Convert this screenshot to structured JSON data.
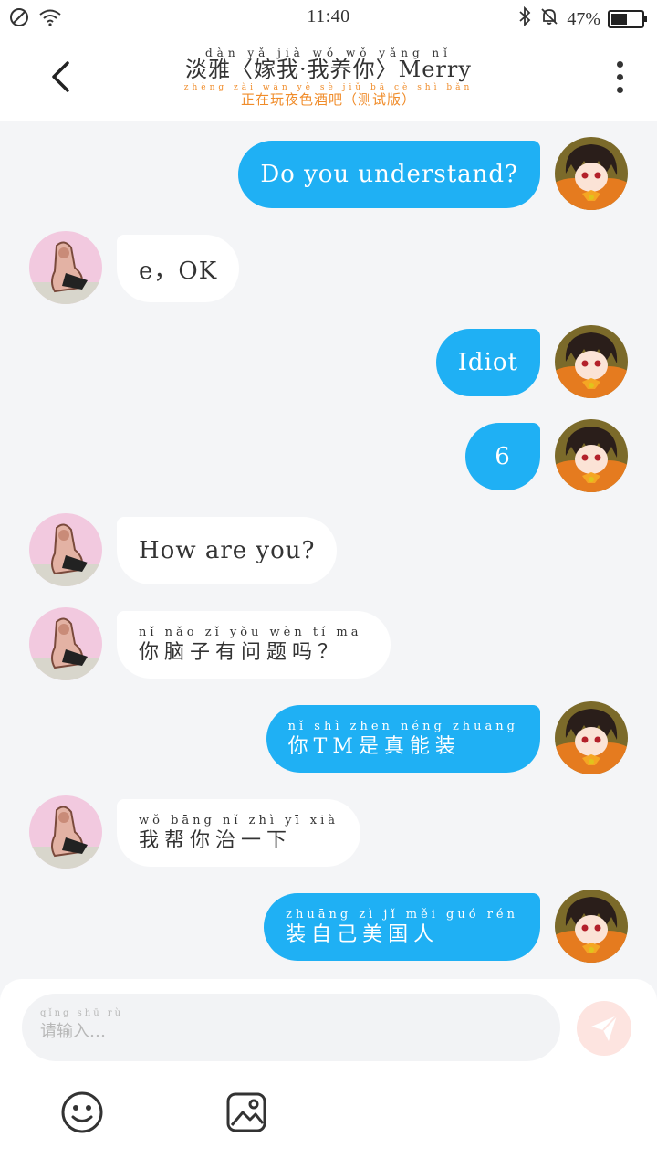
{
  "status_bar": {
    "time": "11:40",
    "battery": "47%",
    "battery_level": 0.47
  },
  "header": {
    "title_pinyin": "dàn yǎ  jià wǒ  wǒ yǎng nǐ",
    "title": "淡雅〈嫁我·我养你〉Merry",
    "subtitle_pinyin": "zhèng zài wán yè sè jiǔ bā  cè shì bǎn",
    "subtitle": "正在玩夜色酒吧（测试版）"
  },
  "messages": [
    {
      "side": "right",
      "text": "Do you understand?"
    },
    {
      "side": "left",
      "text": "e，OK"
    },
    {
      "side": "right",
      "text": "Idiot"
    },
    {
      "side": "right",
      "text": "6"
    },
    {
      "side": "left",
      "text": "How are you?"
    },
    {
      "side": "left",
      "pinyin": "nǐ nǎo zǐ yǒu wèn tí ma",
      "text": "你脑子有问题吗？"
    },
    {
      "side": "right",
      "pinyin": "nǐ     shì zhēn néng zhuāng",
      "text": "你TM是真能装"
    },
    {
      "side": "left",
      "pinyin": "wǒ bāng nǐ zhì yī xià",
      "text": "我帮你治一下"
    },
    {
      "side": "right",
      "pinyin": "zhuāng zì jǐ měi guó rén",
      "text": "装自己美国人"
    }
  ],
  "composer": {
    "placeholder_pinyin": "qǐng shū rù",
    "placeholder": "请输入…"
  },
  "colors": {
    "accent": "#1fb0f4",
    "subtitle": "#f08c2a",
    "send_button": "#fde4e0"
  },
  "icons": [
    "no-disturb-icon",
    "wifi-icon",
    "bluetooth-icon",
    "mute-bell-icon",
    "battery-icon",
    "back-chevron-icon",
    "more-vertical-icon",
    "send-icon",
    "emoji-icon",
    "image-icon"
  ]
}
